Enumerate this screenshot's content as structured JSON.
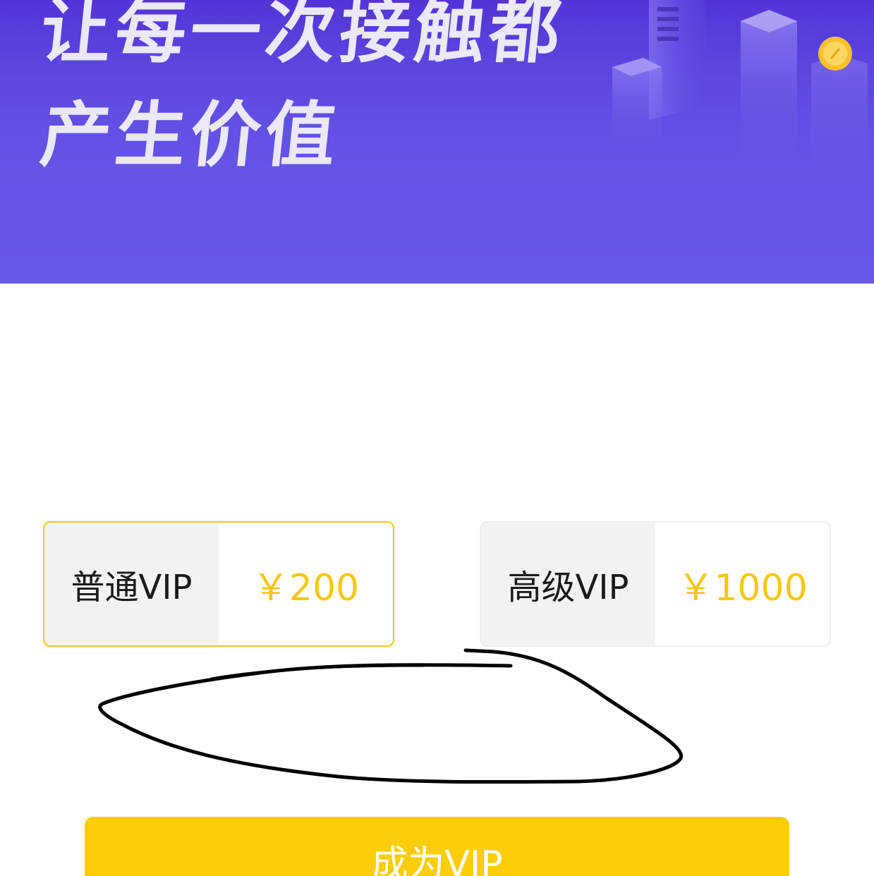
{
  "hero": {
    "line1": "让每一次接触都",
    "line2": "产生价值"
  },
  "plans": [
    {
      "name": "普通VIP",
      "price": "￥200",
      "selected": true
    },
    {
      "name": "高级VIP",
      "price": "￥1000",
      "selected": false
    }
  ],
  "cta": {
    "label": "成为VIP"
  },
  "colors": {
    "hero_bg": "#6452e6",
    "accent_yellow": "#fdcd09",
    "price_yellow": "#f5c714",
    "card_name_bg": "#f2f2f2",
    "selected_border": "#f6c915"
  }
}
